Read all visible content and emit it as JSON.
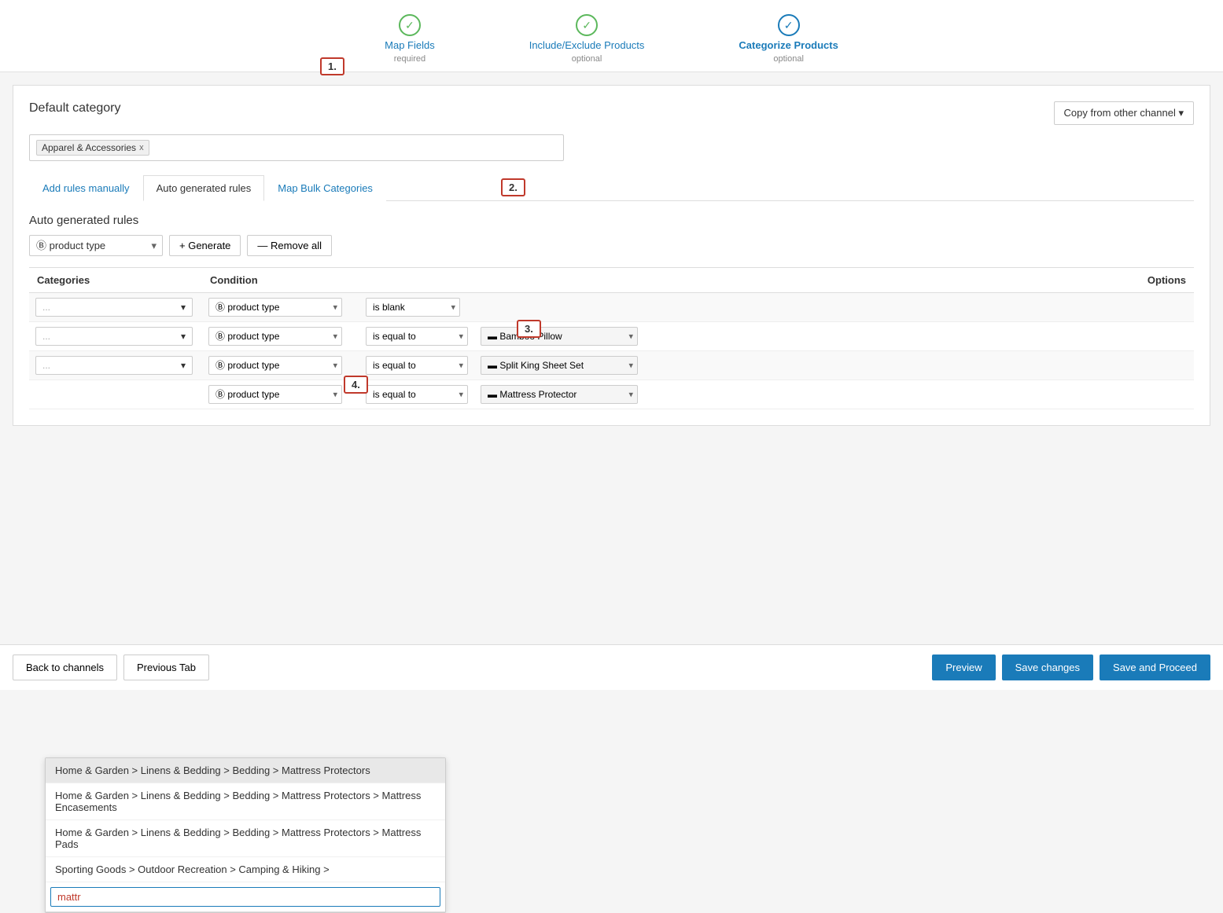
{
  "wizard": {
    "steps": [
      {
        "label": "Map Fields",
        "sub": "required",
        "status": "done",
        "active": false
      },
      {
        "label": "Include/Exclude Products",
        "sub": "optional",
        "status": "done",
        "active": false
      },
      {
        "label": "Categorize Products",
        "sub": "optional",
        "status": "done",
        "active": true
      }
    ]
  },
  "page": {
    "default_category_label": "Default category",
    "default_category_tag": "Apparel & Accessories",
    "copy_btn": "Copy from other channel",
    "tabs": [
      {
        "label": "Add rules manually",
        "active": false
      },
      {
        "label": "Auto generated rules",
        "active": true
      },
      {
        "label": "Map Bulk Categories",
        "active": false
      }
    ],
    "auto_section_title": "Auto generated rules",
    "product_type_label": "product type",
    "generate_btn": "+ Generate",
    "remove_all_btn": "— Remove all",
    "table_headers": [
      "Categories",
      "Condition",
      "",
      "",
      "Options"
    ],
    "rows": [
      {
        "category_text": "...",
        "condition_field": "product type",
        "operator": "is blank",
        "value": "",
        "has_value": false
      },
      {
        "category_text": "...",
        "condition_field": "product type",
        "operator": "is equal to",
        "value": "Bamboo Pillow",
        "has_value": true
      },
      {
        "category_text": "...",
        "condition_field": "product type",
        "operator": "is equal to",
        "value": "Split King Sheet Set",
        "has_value": true
      },
      {
        "category_text": "...",
        "condition_field": "product type",
        "operator": "is equal to",
        "value": "Mattress Protector",
        "has_value": true,
        "search_active": true,
        "search_value": "mattr"
      }
    ],
    "dropdown": {
      "search_placeholder": "mattr",
      "items": [
        {
          "text": "Home & Garden > Linens & Bedding > Bedding > Mattress Protectors",
          "selected": true
        },
        {
          "text": "Home & Garden > Linens & Bedding > Bedding > Mattress Protectors > Mattress Encasements",
          "selected": false
        },
        {
          "text": "Home & Garden > Linens & Bedding > Bedding > Mattress Protectors > Mattress Pads",
          "selected": false
        },
        {
          "text": "Sporting Goods > Outdoor Recreation > Camping & Hiking >",
          "selected": false
        }
      ]
    }
  },
  "footer": {
    "back_btn": "Back to channels",
    "prev_btn": "Previous Tab",
    "preview_btn": "Preview",
    "save_btn": "Save changes",
    "proceed_btn": "Save and Proceed"
  },
  "annotations": [
    {
      "id": "1",
      "label": "1."
    },
    {
      "id": "2",
      "label": "2."
    },
    {
      "id": "3",
      "label": "3."
    },
    {
      "id": "4",
      "label": "4."
    }
  ]
}
